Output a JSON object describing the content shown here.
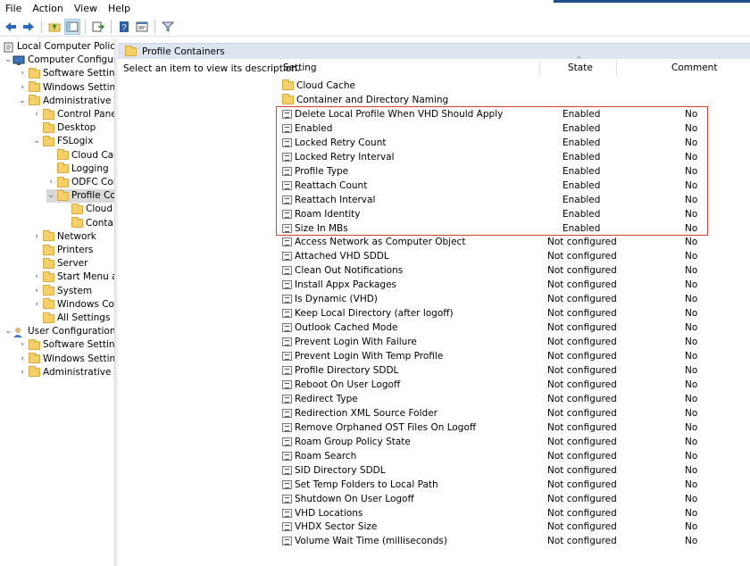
{
  "menu": [
    "File",
    "Action",
    "View",
    "Help"
  ],
  "toolbar_icons": [
    "back-arrow-icon",
    "forward-arrow-icon",
    "up-folder-icon",
    "show-hide-tree-icon",
    "export-list-icon",
    "help-icon",
    "properties-icon",
    "filter-icon"
  ],
  "tree": {
    "items": [
      {
        "label": "Local Computer Policy",
        "depth": 0,
        "chevron": "",
        "icon": "policy",
        "name": "tree-item-local-computer-policy"
      },
      {
        "label": "Computer Configura",
        "depth": 0,
        "chevron": "expanded",
        "icon": "pc",
        "name": "tree-item-computer-configuration"
      },
      {
        "label": "Software Settings",
        "depth": 1,
        "chevron": "collapsed",
        "icon": "folder",
        "name": "tree-item-software-settings"
      },
      {
        "label": "Windows Setting",
        "depth": 1,
        "chevron": "collapsed",
        "icon": "folder",
        "name": "tree-item-windows-settings"
      },
      {
        "label": "Administrative Te",
        "depth": 1,
        "chevron": "expanded",
        "icon": "folder",
        "name": "tree-item-administrative-templates"
      },
      {
        "label": "Control Panel",
        "depth": 2,
        "chevron": "collapsed",
        "icon": "folder",
        "name": "tree-item-control-panel"
      },
      {
        "label": "Desktop",
        "depth": 2,
        "chevron": "",
        "icon": "folder",
        "name": "tree-item-desktop"
      },
      {
        "label": "FSLogix",
        "depth": 2,
        "chevron": "expanded",
        "icon": "folder",
        "name": "tree-item-fslogix"
      },
      {
        "label": "Cloud Cac",
        "depth": 3,
        "chevron": "",
        "icon": "folder",
        "name": "tree-item-cloud-cache"
      },
      {
        "label": "Logging",
        "depth": 3,
        "chevron": "",
        "icon": "folder",
        "name": "tree-item-logging"
      },
      {
        "label": "ODFC Cor",
        "depth": 3,
        "chevron": "collapsed",
        "icon": "folder",
        "name": "tree-item-odfc-containers"
      },
      {
        "label": "Profile Co",
        "depth": 3,
        "chevron": "expanded",
        "icon": "folder",
        "name": "tree-item-profile-containers",
        "selected": true
      },
      {
        "label": "Cloud",
        "depth": 4,
        "chevron": "",
        "icon": "folder",
        "name": "tree-item-profile-cloud"
      },
      {
        "label": "Conta",
        "depth": 4,
        "chevron": "",
        "icon": "folder",
        "name": "tree-item-profile-container-naming"
      },
      {
        "label": "Network",
        "depth": 2,
        "chevron": "collapsed",
        "icon": "folder",
        "name": "tree-item-network"
      },
      {
        "label": "Printers",
        "depth": 2,
        "chevron": "",
        "icon": "folder",
        "name": "tree-item-printers"
      },
      {
        "label": "Server",
        "depth": 2,
        "chevron": "",
        "icon": "folder",
        "name": "tree-item-server"
      },
      {
        "label": "Start Menu ar",
        "depth": 2,
        "chevron": "collapsed",
        "icon": "folder",
        "name": "tree-item-start-menu"
      },
      {
        "label": "System",
        "depth": 2,
        "chevron": "collapsed",
        "icon": "folder",
        "name": "tree-item-system"
      },
      {
        "label": "Windows Cor",
        "depth": 2,
        "chevron": "collapsed",
        "icon": "folder",
        "name": "tree-item-windows-components"
      },
      {
        "label": "All Settings",
        "depth": 2,
        "chevron": "",
        "icon": "folder",
        "name": "tree-item-all-settings"
      },
      {
        "label": "User Configuration",
        "depth": 0,
        "chevron": "expanded",
        "icon": "user",
        "name": "tree-item-user-configuration"
      },
      {
        "label": "Software Settings",
        "depth": 1,
        "chevron": "collapsed",
        "icon": "folder",
        "name": "tree-item-user-software-settings"
      },
      {
        "label": "Windows Setting",
        "depth": 1,
        "chevron": "collapsed",
        "icon": "folder",
        "name": "tree-item-user-windows-settings"
      },
      {
        "label": "Administrative Te",
        "depth": 1,
        "chevron": "collapsed",
        "icon": "folder",
        "name": "tree-item-user-administrative-templates"
      }
    ]
  },
  "pane_header": "Profile Containers",
  "description": "Select an item to view its description.",
  "columns": {
    "setting": "Setting",
    "state": "State",
    "comment": "Comment"
  },
  "folders": [
    "Cloud Cache",
    "Container and Directory Naming"
  ],
  "settings": [
    {
      "name": "Delete Local Profile When VHD Should Apply",
      "state": "Enabled",
      "comment": "No"
    },
    {
      "name": "Enabled",
      "state": "Enabled",
      "comment": "No"
    },
    {
      "name": "Locked Retry Count",
      "state": "Enabled",
      "comment": "No"
    },
    {
      "name": "Locked Retry Interval",
      "state": "Enabled",
      "comment": "No"
    },
    {
      "name": "Profile Type",
      "state": "Enabled",
      "comment": "No"
    },
    {
      "name": "Reattach Count",
      "state": "Enabled",
      "comment": "No"
    },
    {
      "name": "Reattach Interval",
      "state": "Enabled",
      "comment": "No"
    },
    {
      "name": "Roam Identity",
      "state": "Enabled",
      "comment": "No"
    },
    {
      "name": "Size In MBs",
      "state": "Enabled",
      "comment": "No"
    },
    {
      "name": "Access Network as Computer Object",
      "state": "Not configured",
      "comment": "No"
    },
    {
      "name": "Attached VHD SDDL",
      "state": "Not configured",
      "comment": "No"
    },
    {
      "name": "Clean Out Notifications",
      "state": "Not configured",
      "comment": "No"
    },
    {
      "name": "Install Appx Packages",
      "state": "Not configured",
      "comment": "No"
    },
    {
      "name": "Is Dynamic (VHD)",
      "state": "Not configured",
      "comment": "No"
    },
    {
      "name": "Keep Local Directory (after logoff)",
      "state": "Not configured",
      "comment": "No"
    },
    {
      "name": "Outlook Cached Mode",
      "state": "Not configured",
      "comment": "No"
    },
    {
      "name": "Prevent Login With Failure",
      "state": "Not configured",
      "comment": "No"
    },
    {
      "name": "Prevent Login With Temp Profile",
      "state": "Not configured",
      "comment": "No"
    },
    {
      "name": "Profile Directory SDDL",
      "state": "Not configured",
      "comment": "No"
    },
    {
      "name": "Reboot On User Logoff",
      "state": "Not configured",
      "comment": "No"
    },
    {
      "name": "Redirect Type",
      "state": "Not configured",
      "comment": "No"
    },
    {
      "name": "Redirection XML Source Folder",
      "state": "Not configured",
      "comment": "No"
    },
    {
      "name": "Remove Orphaned OST Files On Logoff",
      "state": "Not configured",
      "comment": "No"
    },
    {
      "name": "Roam Group Policy State",
      "state": "Not configured",
      "comment": "No"
    },
    {
      "name": "Roam Search",
      "state": "Not configured",
      "comment": "No"
    },
    {
      "name": "SID Directory SDDL",
      "state": "Not configured",
      "comment": "No"
    },
    {
      "name": "Set Temp Folders to Local Path",
      "state": "Not configured",
      "comment": "No"
    },
    {
      "name": "Shutdown On User Logoff",
      "state": "Not configured",
      "comment": "No"
    },
    {
      "name": "VHD Locations",
      "state": "Not configured",
      "comment": "No"
    },
    {
      "name": "VHDX Sector Size",
      "state": "Not configured",
      "comment": "No"
    },
    {
      "name": "Volume Wait Time (milliseconds)",
      "state": "Not configured",
      "comment": "No"
    }
  ],
  "colors": {
    "highlight": "#d9412b",
    "header_bg": "#dde6f0",
    "selected_bg": "#d9d9d9",
    "folder": "#f5cf68"
  }
}
